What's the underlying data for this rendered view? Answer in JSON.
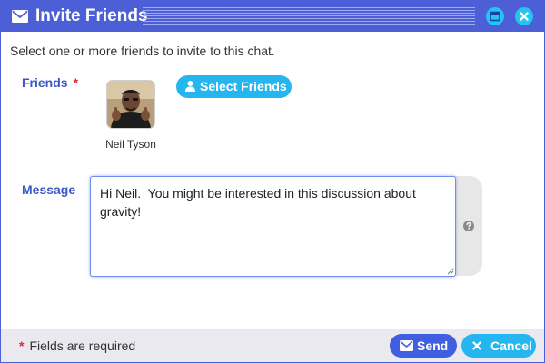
{
  "window": {
    "title": "Invite Friends",
    "title_icon": "envelope-icon",
    "controls": [
      "maximize-icon",
      "close-icon"
    ]
  },
  "instruction": "Select one or more friends to invite to this chat.",
  "friends": {
    "label": "Friends",
    "required_marker": "*",
    "select_button": "Select Friends",
    "selected": [
      {
        "name": "Neil Tyson",
        "avatar": "profile-photo"
      }
    ]
  },
  "message": {
    "label": "Message",
    "value": "Hi Neil.  You might be interested in this discussion about gravity!",
    "help_icon": "question-circle-icon"
  },
  "footer": {
    "required_marker": "*",
    "note": "Fields are required",
    "send_label": "Send",
    "cancel_label": "Cancel"
  },
  "colors": {
    "primary": "#4d5fd6",
    "accent": "#26b6ef",
    "label": "#3b57c8",
    "required": "#e0263a",
    "footer_bg": "#e9e9ef"
  }
}
